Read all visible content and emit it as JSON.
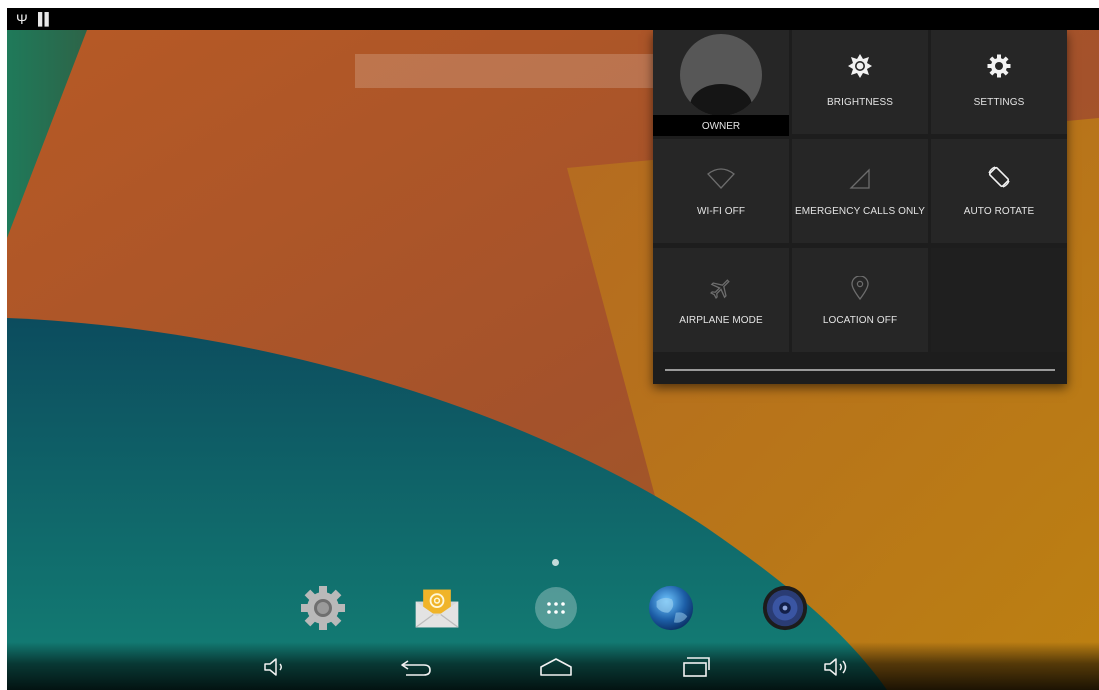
{
  "status_bar": {
    "icons": [
      "usb-icon",
      "sd-card-icon"
    ],
    "usb_glyph": "Ψ",
    "sd_glyph": "▌▌"
  },
  "quick_settings": {
    "tiles": [
      {
        "id": "owner",
        "label": "OWNER",
        "icon": "avatar"
      },
      {
        "id": "brightness",
        "label": "BRIGHTNESS",
        "icon": "brightness-icon"
      },
      {
        "id": "settings",
        "label": "SETTINGS",
        "icon": "gear-icon"
      },
      {
        "id": "wifi",
        "label": "WI-FI OFF",
        "icon": "wifi-off-icon"
      },
      {
        "id": "cell",
        "label": "EMERGENCY CALLS ONLY",
        "icon": "signal-icon"
      },
      {
        "id": "rotate",
        "label": "AUTO ROTATE",
        "icon": "rotate-icon"
      },
      {
        "id": "airplane",
        "label": "AIRPLANE MODE",
        "icon": "airplane-icon"
      },
      {
        "id": "location",
        "label": "LOCATION OFF",
        "icon": "location-icon"
      }
    ]
  },
  "dock": {
    "apps": [
      "settings-app-icon",
      "email-app-icon",
      "app-drawer-icon",
      "browser-app-icon",
      "music-app-icon"
    ]
  },
  "nav_bar": {
    "buttons": [
      "volume-down-icon",
      "back-icon",
      "home-icon",
      "recents-icon",
      "volume-up-icon"
    ]
  },
  "colors": {
    "wallpaper_orange": "#a85225",
    "wallpaper_yellow": "#bb7d17",
    "wallpaper_teal": "#0f5e6a",
    "wallpaper_green": "#2b6a57",
    "panel_bg": "#1d1d1d",
    "tile_bg": "#262626"
  }
}
